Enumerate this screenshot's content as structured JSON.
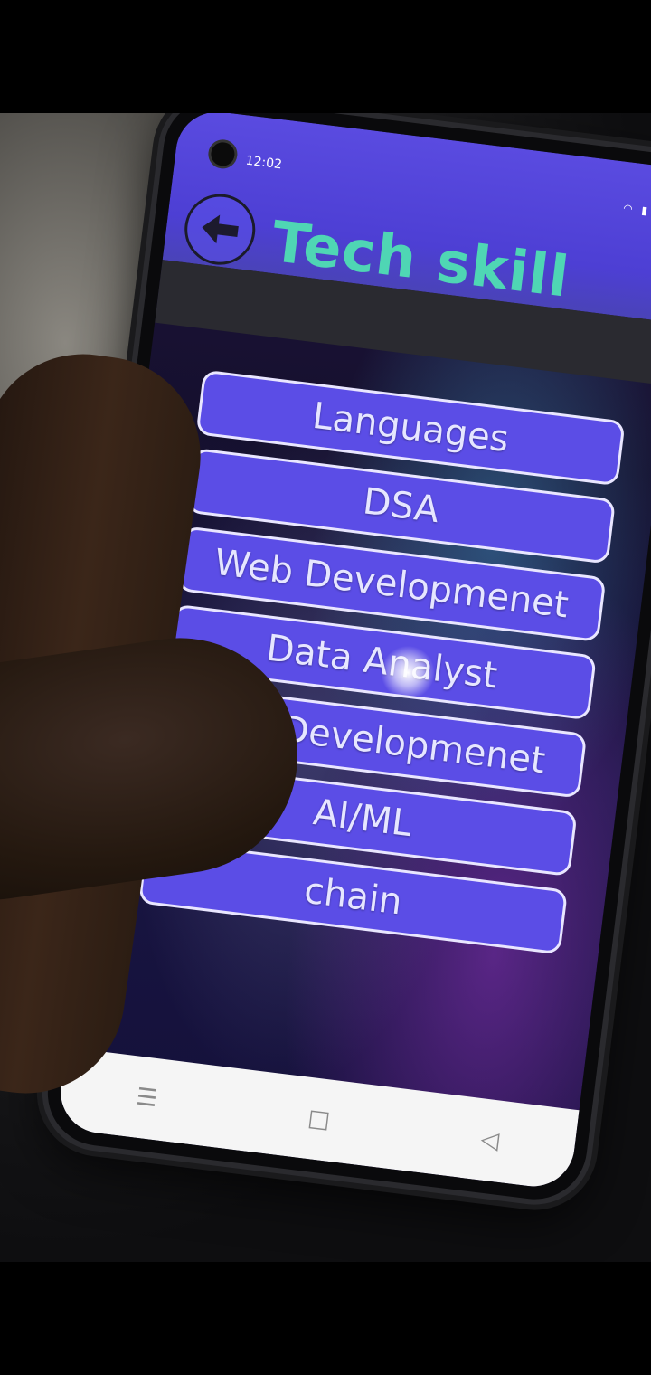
{
  "status_bar": {
    "time": "12:02"
  },
  "header": {
    "title": "Tech skill",
    "back_icon": "arrow-left-icon"
  },
  "menu": {
    "items": [
      {
        "label": "Languages"
      },
      {
        "label": "DSA"
      },
      {
        "label": "Web Developmenet"
      },
      {
        "label": "Data Analyst"
      },
      {
        "label": "App Developmenet"
      },
      {
        "label": "AI/ML"
      },
      {
        "label": "chain"
      }
    ]
  },
  "colors": {
    "header": "#5a4be0",
    "title": "#4fd6b4",
    "button_fill": "#5b4de6",
    "button_border": "#e9e6ff"
  },
  "nav": {
    "menu_icon": "hamburger-icon",
    "home_icon": "square-icon",
    "back_icon": "triangle-back-icon"
  }
}
